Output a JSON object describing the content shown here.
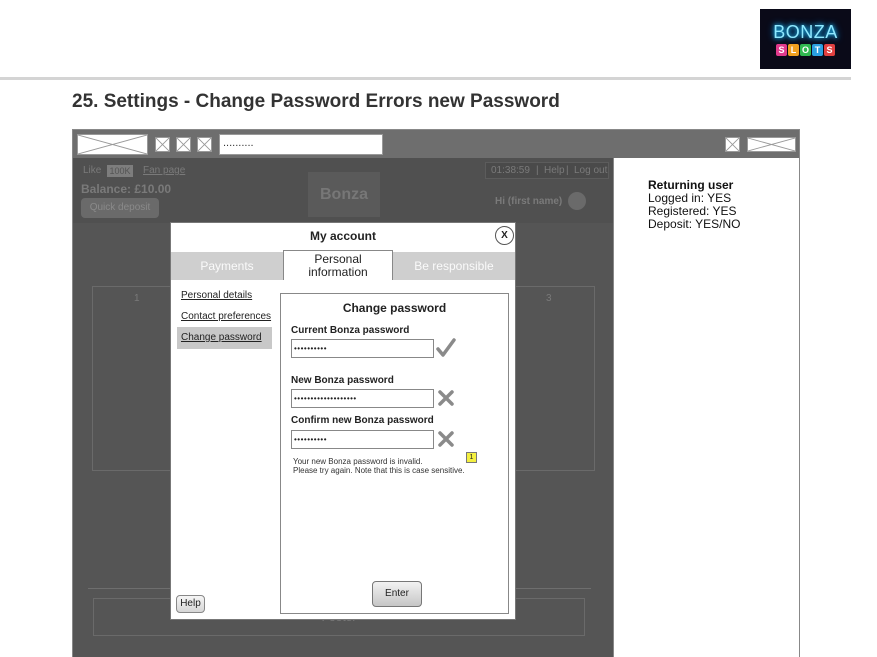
{
  "logo": {
    "word": "BONZA",
    "letters": [
      {
        "char": "S",
        "color": "#e03a8c"
      },
      {
        "char": "L",
        "color": "#f0a020"
      },
      {
        "char": "O",
        "color": "#30b850"
      },
      {
        "char": "T",
        "color": "#2aa0e0"
      },
      {
        "char": "S",
        "color": "#e04040"
      }
    ]
  },
  "page_title": "25. Settings - Change Password Errors new Password",
  "browser": {
    "url_value": ".........."
  },
  "site": {
    "like_label": "Like",
    "like_count": "100K",
    "fan_page": "Fan page",
    "time": "01:38:59",
    "help": "Help",
    "logout": "Log out",
    "separator": "|",
    "balance": "Balance: £10.00",
    "quick_deposit": "Quick deposit",
    "site_logo": "Bonza",
    "user_name": "Hi (first name)",
    "game_left_number": "1",
    "game_right_number": "3",
    "footer": "Footer"
  },
  "notes": {
    "heading": "Returning user",
    "logged_in": "Logged in: YES",
    "registered": "Registered: YES",
    "deposit": "Deposit: YES/NO"
  },
  "modal": {
    "title": "My account",
    "close_label": "X",
    "tabs": {
      "payments": "Payments",
      "personal_line1": "Personal",
      "personal_line2": "information",
      "be_responsible": "Be responsible"
    },
    "sidebar": {
      "personal_details": "Personal details",
      "contact_preferences": "Contact preferences",
      "change_password": "Change password"
    },
    "help_label": "Help"
  },
  "change_password": {
    "title": "Change password",
    "current_label": "Current Bonza password",
    "current_value": "••••••••••",
    "new_label": "New Bonza password",
    "new_value": "•••••••••••••••••••",
    "confirm_label": "Confirm new Bonza password",
    "confirm_value": "••••••••••",
    "error_line1": "Your new Bonza password is invalid.",
    "error_line2": "Please try again. Note that this is case sensitive.",
    "note_number": "1",
    "enter_label": "Enter"
  },
  "colors": {
    "valid_check": "#8a8a8a",
    "invalid_cross": "#8a8a8a",
    "note_badge": "#f4f040"
  }
}
